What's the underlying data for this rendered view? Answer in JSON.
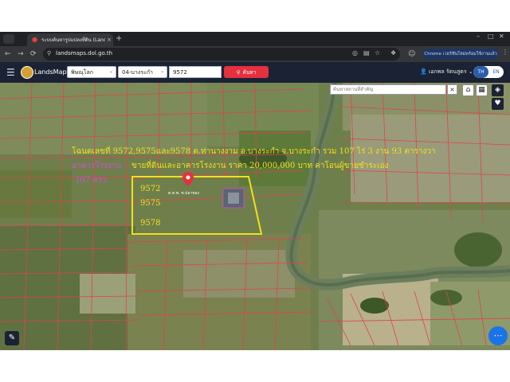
{
  "browser": {
    "tab_title": "ระบบค้นหารูปแปลงที่ดิน (Lands...",
    "tab_close": "×",
    "new_tab": "+",
    "url": "landsmaps.dol.go.th",
    "chrome_promo": "Chrome เวอร์ชันใหม่พร้อมใช้งานแล้ว",
    "nav_back": "←",
    "nav_forward": "→",
    "nav_reload": "⟳"
  },
  "app": {
    "brand": "LandsMaps",
    "province": "พิษณุโลก",
    "district": "04-บางระกำ",
    "parcel_number": "9572",
    "search_label": "ค้นหา",
    "user_name": "เอกพล รัตนสูตร",
    "lang_th": "TH",
    "lang_en": "EN"
  },
  "map": {
    "search_placeholder": "ค้นหาสถานที่สำคัญ",
    "clear": "×",
    "overlay_line1": "โฉนดเลขที่ 9572,9575และ9578 ต.ท่านางงาม อ.บางระกำ จ.บางระกำ รวม  107 ไร่ 3 งาน 93 ตารางวา",
    "overlay_line2_a": "อาคารโรงงาน",
    "overlay_line2_b": "ขายที่ดินและอาคารโรงงาน ราคา 20,000,000 บาท ค่าโอนผู้ขายชำระเอง",
    "overlay_line3": "107 ตรว.",
    "plot_labels": [
      "9572",
      "9575",
      "9578"
    ],
    "building_label": "ต.ท.พ. ช.ปลาทอง"
  },
  "colors": {
    "accent_red": "#e5303f",
    "header_bg": "#1b2233",
    "overlay_yellow": "#f2e01a",
    "overlay_magenta": "#d24cd2",
    "parcel_line": "#e0434b",
    "river": "#6b7f5e"
  }
}
